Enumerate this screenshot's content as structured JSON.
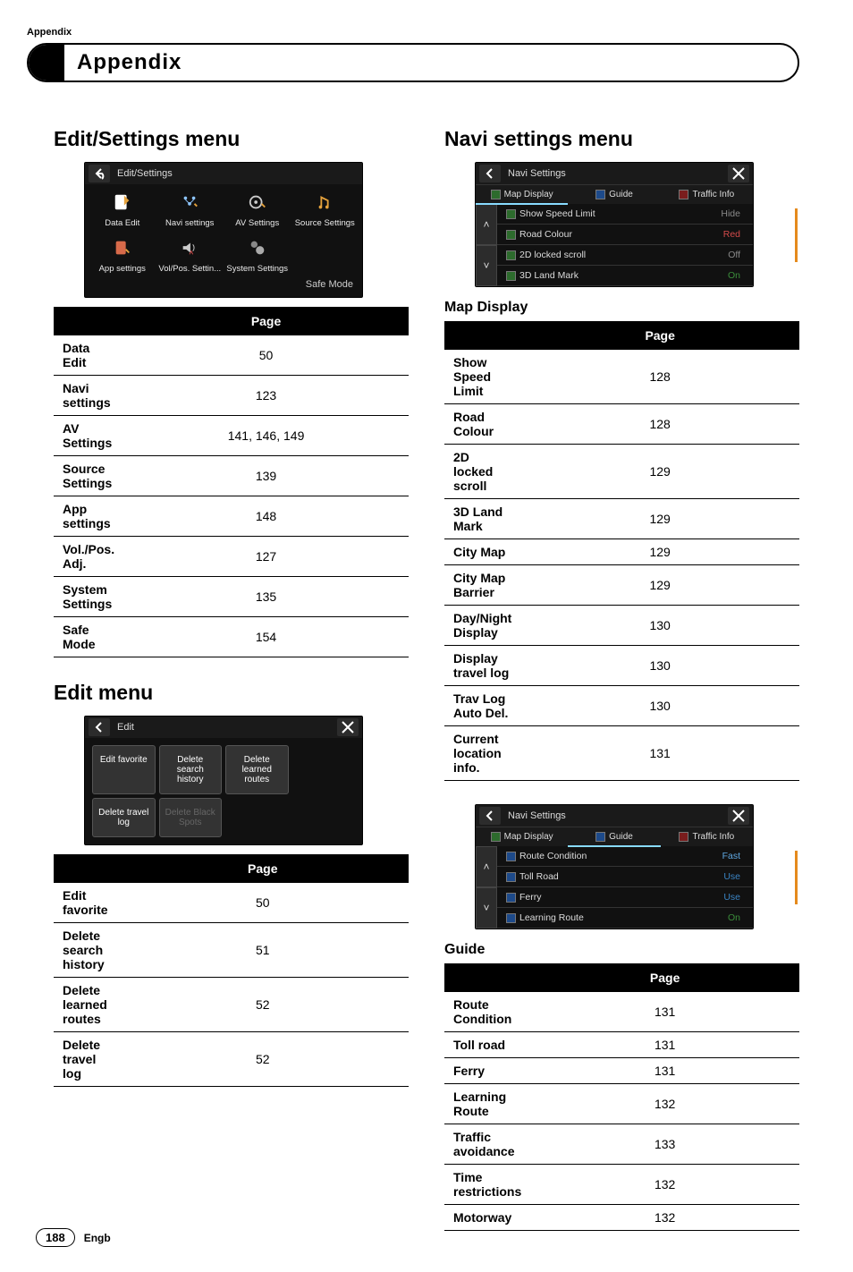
{
  "header": {
    "running": "Appendix",
    "chapter": "Appendix"
  },
  "left": {
    "section1": {
      "title": "Edit/Settings menu",
      "device": {
        "title": "Edit/Settings",
        "icons": [
          "Data Edit",
          "Navi settings",
          "AV Settings",
          "Source Settings",
          "App settings",
          "Vol/Pos. Settin...",
          "System Settings"
        ],
        "footer": "Safe Mode"
      },
      "table_header": "Page",
      "rows": [
        {
          "name": "Data Edit",
          "page": "50"
        },
        {
          "name": "Navi settings",
          "page": "123"
        },
        {
          "name": "AV Settings",
          "page": "141, 146, 149"
        },
        {
          "name": "Source Settings",
          "page": "139"
        },
        {
          "name": "App settings",
          "page": "148"
        },
        {
          "name": "Vol./Pos. Adj.",
          "page": "127"
        },
        {
          "name": "System Settings",
          "page": "135"
        },
        {
          "name": "Safe Mode",
          "page": "154"
        }
      ]
    },
    "section2": {
      "title": "Edit menu",
      "device": {
        "title": "Edit",
        "grid": [
          "Edit favorite",
          "Delete search history",
          "Delete learned routes",
          "Delete travel log",
          "Delete Black Spots"
        ]
      },
      "table_header": "Page",
      "rows": [
        {
          "name": "Edit favorite",
          "page": "50"
        },
        {
          "name": "Delete search history",
          "page": "51"
        },
        {
          "name": "Delete learned routes",
          "page": "52"
        },
        {
          "name": "Delete travel log",
          "page": "52"
        }
      ]
    }
  },
  "right": {
    "section1": {
      "title": "Navi settings menu",
      "device": {
        "title": "Navi Settings",
        "tabs": [
          "Map Display",
          "Guide",
          "Traffic Info"
        ],
        "rows": [
          {
            "label": "Show Speed Limit",
            "value": "Hide"
          },
          {
            "label": "Road Colour",
            "value": "Red"
          },
          {
            "label": "2D locked scroll",
            "value": "Off"
          },
          {
            "label": "3D Land Mark",
            "value": "On"
          }
        ]
      }
    },
    "sub1": {
      "title": "Map Display",
      "table_header": "Page",
      "rows": [
        {
          "name": "Show Speed Limit",
          "page": "128"
        },
        {
          "name": "Road Colour",
          "page": "128"
        },
        {
          "name": "2D locked scroll",
          "page": "129"
        },
        {
          "name": "3D Land Mark",
          "page": "129"
        },
        {
          "name": "City Map",
          "page": "129"
        },
        {
          "name": "City Map Barrier",
          "page": "129"
        },
        {
          "name": "Day/Night Display",
          "page": "130"
        },
        {
          "name": "Display travel log",
          "page": "130"
        },
        {
          "name": "Trav Log Auto Del.",
          "page": "130"
        },
        {
          "name": "Current location info.",
          "page": "131"
        }
      ]
    },
    "device2": {
      "title": "Navi Settings",
      "tabs": [
        "Map Display",
        "Guide",
        "Traffic Info"
      ],
      "rows": [
        {
          "label": "Route Condition",
          "value": "Fast"
        },
        {
          "label": "Toll Road",
          "value": "Use"
        },
        {
          "label": "Ferry",
          "value": "Use"
        },
        {
          "label": "Learning Route",
          "value": "On"
        }
      ]
    },
    "sub2": {
      "title": "Guide",
      "table_header": "Page",
      "rows": [
        {
          "name": "Route Condition",
          "page": "131"
        },
        {
          "name": "Toll road",
          "page": "131"
        },
        {
          "name": "Ferry",
          "page": "131"
        },
        {
          "name": "Learning Route",
          "page": "132"
        },
        {
          "name": "Traffic avoidance",
          "page": "133"
        },
        {
          "name": "Time restrictions",
          "page": "132"
        },
        {
          "name": "Motorway",
          "page": "132"
        }
      ]
    }
  },
  "footer": {
    "pageno": "188",
    "lang": "Engb"
  }
}
